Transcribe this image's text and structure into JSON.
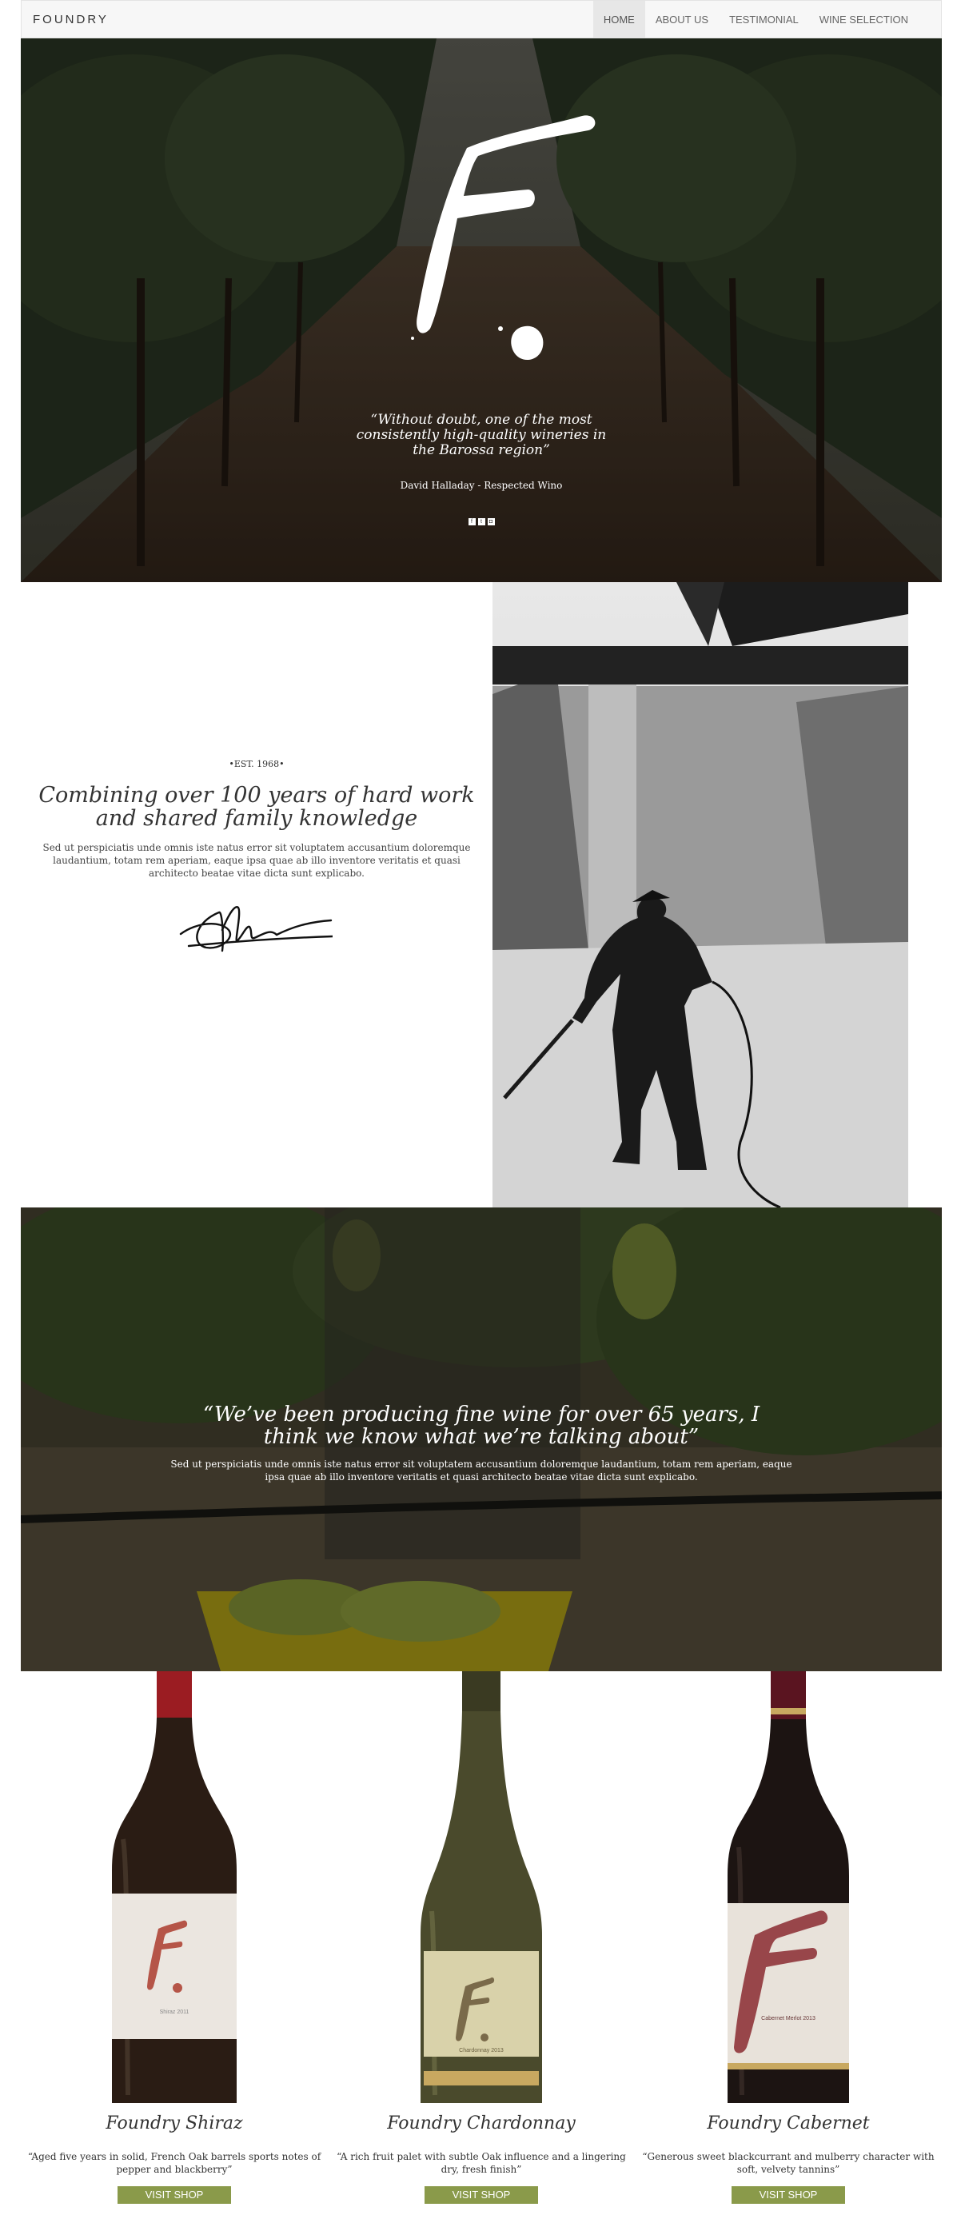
{
  "nav": {
    "brand": "FOUNDRY",
    "items": [
      {
        "label": "HOME",
        "active": true
      },
      {
        "label": "ABOUT US",
        "active": false
      },
      {
        "label": "TESTIMONIAL",
        "active": false
      },
      {
        "label": "WINE SELECTION",
        "active": false
      }
    ]
  },
  "hero": {
    "quote": "“Without doubt, one of the most consistently high-quality wineries in the Barossa region”",
    "author": "David Halladay - Respected Wino",
    "social_icons": [
      "facebook-icon",
      "twitter-icon",
      "instagram-icon"
    ]
  },
  "about": {
    "est": "•EST. 1968•",
    "title": "Combining over 100 years of hard work and shared family knowledge",
    "body": "Sed ut perspiciatis unde omnis iste natus error sit voluptatem accusantium doloremque laudantium, totam rem aperiam, eaque ipsa quae ab illo inventore veritatis et quasi architecto beatae vitae dicta sunt explicabo."
  },
  "testimonial": {
    "quote": "“We’ve been producing fine wine for over 65 years, I think we know what we’re talking about”",
    "body": "Sed ut perspiciatis unde omnis iste natus error sit voluptatem accusantium doloremque laudantium, totam rem aperiam, eaque ipsa quae ab illo inventore veritatis et quasi architecto beatae vitae dicta sunt explicabo."
  },
  "wines": [
    {
      "name": "Foundry Shiraz",
      "description": "“Aged five years in solid, French Oak barrels sports notes of pepper and blackberry”",
      "button": "VISIT SHOP",
      "label_text": "Shiraz 2011",
      "glass_color": "#2a1c14",
      "capsule_color": "#9b1c22"
    },
    {
      "name": "Foundry Chardonnay",
      "description": "“A rich fruit palet with subtle Oak influence and a lingering dry, fresh finish”",
      "button": "VISIT SHOP",
      "label_text": "Chardonnay 2013",
      "glass_color": "#4a4a2c",
      "capsule_color": "#3a3a22"
    },
    {
      "name": "Foundry Cabernet",
      "description": "“Generous sweet blackcurrant and mulberry character with soft, velvety tannins”",
      "button": "VISIT SHOP",
      "label_text": "Cabernet Merlot 2013",
      "glass_color": "#1c1412",
      "capsule_color": "#5a1420"
    }
  ],
  "colors": {
    "button": "#8a9a4a",
    "nav_bg": "#f7f7f7",
    "nav_active": "#e7e7e7"
  }
}
